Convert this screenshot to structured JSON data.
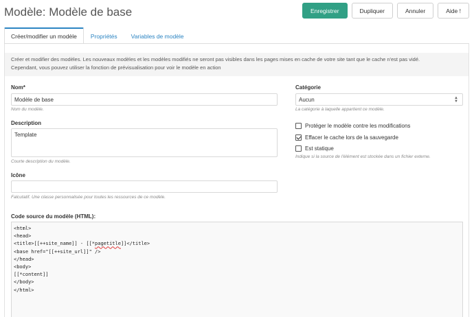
{
  "header": {
    "title": "Modèle: Modèle de base",
    "actions": {
      "save": "Enregistrer",
      "duplicate": "Dupliquer",
      "cancel": "Annuler",
      "help": "Aide !"
    }
  },
  "tabs": [
    {
      "label": "Créer/modifier un modèle",
      "active": true
    },
    {
      "label": "Propriétés",
      "active": false
    },
    {
      "label": "Variables de modèle",
      "active": false
    }
  ],
  "intro": {
    "line1": "Créer et modifier des modèles. Les nouveaux modèles et les modèles modifiés ne seront pas visibles dans les pages mises en cache de votre site tant que le cache n'est pas vidé.",
    "line2": "Cependant, vous pouvez utiliser la fonction de prévisualisation pour voir le modèle en action"
  },
  "form": {
    "name": {
      "label": "Nom*",
      "value": "Modèle de base",
      "hint": "Nom du modèle."
    },
    "description": {
      "label": "Description",
      "value": "Template",
      "hint": "Courte description du modèle."
    },
    "icon": {
      "label": "Icône",
      "value": "",
      "hint": "Falcutatif. Une classe personnalisée pour toutes les ressources de ce modèle."
    },
    "category": {
      "label": "Catégorie",
      "value": "Aucun",
      "hint": "La catégorie à laquelle appartient ce modèle."
    },
    "options": {
      "protect": {
        "label": "Protéger le modèle contre les modifications",
        "checked": false
      },
      "clear_cache": {
        "label": "Effacer le cache lors de la sauvegarde",
        "checked": true
      },
      "static": {
        "label": "Est statique",
        "checked": false,
        "hint": "Indique si la source de l'élément est stockée dans un fichier externe."
      }
    },
    "code": {
      "label": "Code source du modèle (HTML):",
      "lines": [
        "<html>",
        "<head>",
        "<title>[[++site_name]] - [[*pagetitle]]</title>",
        "<base href=\"[[++site_url]]\" />",
        "</head>",
        "<body>",
        "[[*content]]",
        "</body>",
        "</html>"
      ]
    }
  },
  "colors": {
    "primary": "#31a085",
    "link": "#2b84c2"
  }
}
